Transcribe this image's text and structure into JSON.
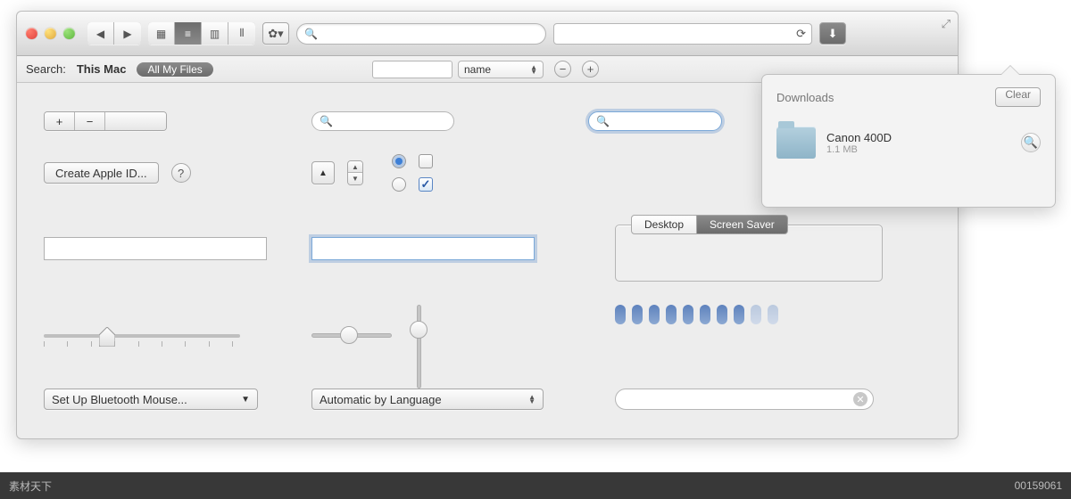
{
  "titlebar": {
    "search_placeholder": ""
  },
  "searchbar": {
    "label": "Search:",
    "scope_active": "This Mac",
    "pill": "All My Files",
    "filter_attr": "name"
  },
  "controls": {
    "plus": "+",
    "minus": "−",
    "create_apple_id": "Create Apple ID...",
    "help": "?",
    "up": "▲",
    "setup_bluetooth": "Set Up Bluetooth Mouse...",
    "popup_language": "Automatic by Language"
  },
  "tabs": {
    "left": "Desktop",
    "right": "Screen Saver"
  },
  "popover": {
    "title": "Downloads",
    "clear": "Clear",
    "item_name": "Canon 400D",
    "item_size": "1.1 MB"
  },
  "footer": {
    "left": "素材天下",
    "right": "00159061"
  }
}
